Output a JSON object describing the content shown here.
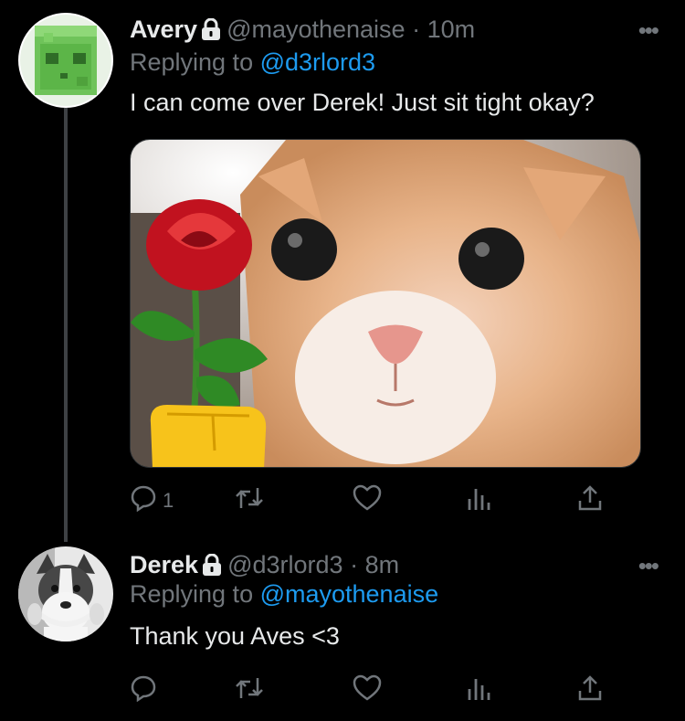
{
  "tweets": [
    {
      "author": "Avery",
      "handle": "@mayothenaise",
      "separator": "·",
      "time": "10m",
      "replying_prefix": "Replying to ",
      "replying_to": "@d3rlord3",
      "text": "I can come over Derek! Just sit tight okay?",
      "avatar": "green-slime-block",
      "media": "cat-holding-rose-photo",
      "reply_count": "1"
    },
    {
      "author": "Derek",
      "handle": "@d3rlord3",
      "separator": "·",
      "time": "8m",
      "replying_prefix": "Replying to ",
      "replying_to": "@mayothenaise",
      "text": "Thank you Aves <3",
      "avatar": "dog-with-headphones",
      "reply_count": ""
    }
  ],
  "icons": [
    "lock-icon",
    "more-icon",
    "reply-icon",
    "retweet-icon",
    "like-icon",
    "analytics-icon",
    "share-icon"
  ],
  "colors": {
    "background": "#000000",
    "text": "#e7e9ea",
    "muted": "#71767b",
    "link": "#1d9bf0"
  }
}
